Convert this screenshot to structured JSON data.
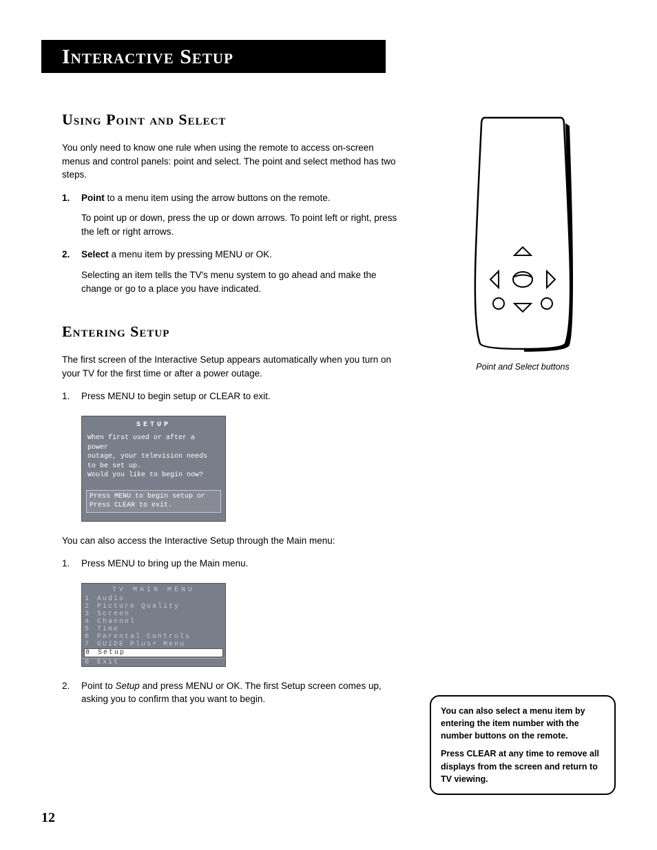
{
  "title": "Interactive Setup",
  "section1": {
    "heading": "Using Point and Select",
    "intro": "You only need to know one rule when using the remote to access on-screen menus and control panels: point and select. The point and select method has two steps.",
    "step1_num": "1.",
    "step1_bold": "Point",
    "step1_rest": " to a menu item using the arrow buttons on the remote.",
    "step1_sub": "To point up or down, press the up or down arrows. To point left or right, press the left or right arrows.",
    "step2_num": "2.",
    "step2_bold": "Select",
    "step2_rest": " a menu item by pressing MENU or OK.",
    "step2_sub": "Selecting an item tells the TV's menu system to go ahead and make the change or go to a place you have indicated."
  },
  "section2": {
    "heading": "Entering Setup",
    "intro": "The first screen of the Interactive Setup appears automatically when you turn on your TV for the first time or after a power outage.",
    "step1_num": "1.",
    "step1_text": "Press MENU to begin setup or CLEAR to exit.",
    "after_screen": "You can also access the Interactive Setup through the Main menu:",
    "step1b_num": "1.",
    "step1b_text": "Press MENU to bring up the Main menu.",
    "step2_num": "2.",
    "step2_pre": "Point to ",
    "step2_em": "Setup",
    "step2_post": " and press MENU or OK. The first Setup screen comes up, asking you to confirm that you want to begin."
  },
  "setup_screen": {
    "title": "SETUP",
    "body": "When first used or after a power\noutage, your television needs\nto be set up.\nWould you like to begin now?",
    "hint": "Press MENU to begin setup or\nPress CLEAR to exit."
  },
  "menu_screen": {
    "title": "TV MAIN MENU",
    "items": [
      {
        "n": "1",
        "label": "Audio"
      },
      {
        "n": "2",
        "label": "Picture Quality"
      },
      {
        "n": "3",
        "label": "Screen"
      },
      {
        "n": "4",
        "label": "Channel"
      },
      {
        "n": "5",
        "label": "Time"
      },
      {
        "n": "6",
        "label": "Parental Controls"
      },
      {
        "n": "7",
        "label": "GUIDE Plus+ Menu"
      },
      {
        "n": "8",
        "label": "Setup"
      },
      {
        "n": "0",
        "label": "Exit"
      }
    ]
  },
  "remote_caption": "Point and Select buttons",
  "tip": {
    "p1": "You can also select a menu item by entering the item number with the number buttons on the remote.",
    "p2": "Press CLEAR at any time to remove all displays from the screen and return to TV viewing."
  },
  "page_number": "12"
}
